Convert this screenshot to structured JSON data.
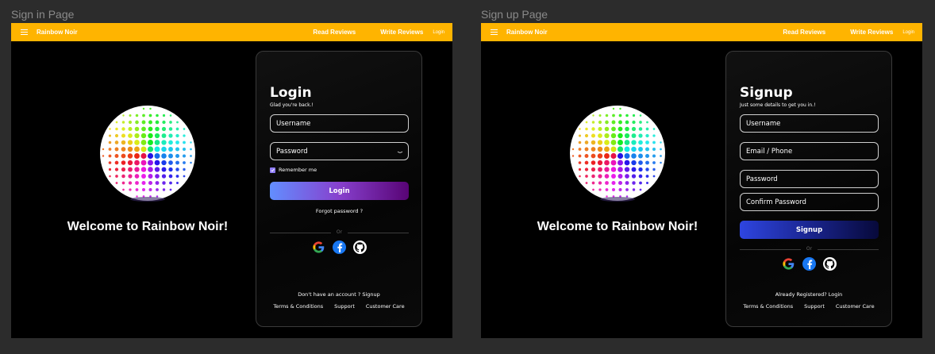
{
  "frames": [
    {
      "label": "Sign in Page",
      "navbar": {
        "brand": "Rainbow Noir",
        "links": [
          "Read Reviews",
          "Write Reviews"
        ],
        "login": "Login",
        "menu_icon": "hamburger-icon"
      },
      "hero": {
        "welcome": "Welcome to Rainbow Noir!"
      },
      "card": {
        "title": "Login",
        "subtitle": "Glad you're back.!",
        "fields": {
          "username": "Username",
          "password": "Password"
        },
        "remember": "Remember me",
        "button": "Login",
        "forgot": "Forgot password ?",
        "or": "Or",
        "bottom": "Don't have an account ? Signup",
        "footer": [
          "Terms & Conditions",
          "Support",
          "Customer Care"
        ]
      }
    },
    {
      "label": "Sign up Page",
      "navbar": {
        "brand": "Rainbow Noir",
        "links": [
          "Read Reviews",
          "Write Reviews"
        ],
        "login": "Login",
        "menu_icon": "hamburger-icon"
      },
      "hero": {
        "welcome": "Welcome to Rainbow Noir!"
      },
      "card": {
        "title": "Signup",
        "subtitle": "Just some details to get you in.!",
        "fields": {
          "username": "Username",
          "email": "Email / Phone",
          "password": "Password",
          "confirm": "Confirm Password"
        },
        "button": "Signup",
        "or": "Or",
        "bottom": "Already Registered? Login",
        "footer": [
          "Terms & Conditions",
          "Support",
          "Customer Care"
        ]
      }
    }
  ],
  "colors": {
    "navbar": "#ffb400",
    "login_gradient": [
      "#628eff",
      "#8740cd",
      "#580475"
    ],
    "signup_gradient": [
      "#2e45e0",
      "#1a2590",
      "#07093a"
    ],
    "checkbox": "#8e7cf7"
  },
  "icons": {
    "google": "google-icon",
    "facebook": "facebook-icon",
    "github": "github-icon",
    "eye": "eye-icon"
  }
}
